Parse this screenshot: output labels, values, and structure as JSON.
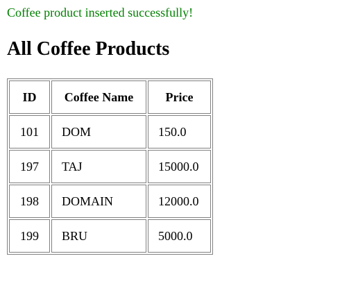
{
  "status": {
    "message": "Coffee product inserted successfully!",
    "color": "#008000"
  },
  "page": {
    "title": "All Coffee Products"
  },
  "table": {
    "headers": [
      "ID",
      "Coffee Name",
      "Price"
    ],
    "rows": [
      [
        "101",
        "DOM",
        "150.0"
      ],
      [
        "197",
        "TAJ",
        "15000.0"
      ],
      [
        "198",
        "DOMAIN",
        "12000.0"
      ],
      [
        "199",
        "BRU",
        "5000.0"
      ]
    ]
  }
}
